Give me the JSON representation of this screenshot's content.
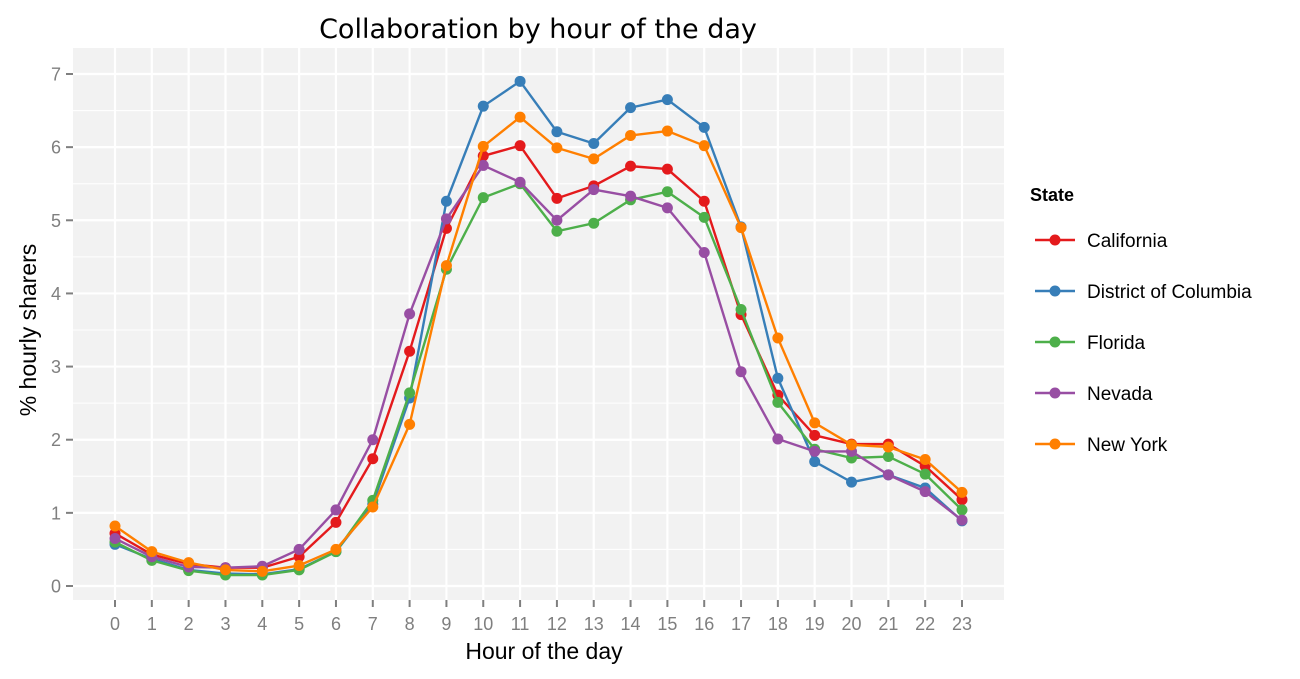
{
  "chart_data": {
    "type": "line",
    "title": "Collaboration by hour of the day",
    "xlabel": "Hour of the day",
    "ylabel": "%  hourly sharers",
    "x": [
      0,
      1,
      2,
      3,
      4,
      5,
      6,
      7,
      8,
      9,
      10,
      11,
      12,
      13,
      14,
      15,
      16,
      17,
      18,
      19,
      20,
      21,
      22,
      23
    ],
    "x_tick_labels": [
      "0",
      "1",
      "2",
      "3",
      "4",
      "5",
      "6",
      "7",
      "8",
      "9",
      "10",
      "11",
      "12",
      "13",
      "14",
      "15",
      "16",
      "17",
      "18",
      "19",
      "20",
      "21",
      "22",
      "23"
    ],
    "y_ticks": [
      0,
      1,
      2,
      3,
      4,
      5,
      6,
      7
    ],
    "y_tick_labels": [
      "0",
      "1",
      "2",
      "3",
      "4",
      "5",
      "6",
      "7"
    ],
    "ylim": [
      -0.2,
      7.3
    ],
    "xlim": [
      -1.2,
      24.2
    ],
    "grid": true,
    "legend": {
      "title": "State",
      "position": "right"
    },
    "series": [
      {
        "name": "California",
        "color": "#e41a1c",
        "values": [
          0.72,
          0.43,
          0.3,
          0.25,
          0.25,
          0.4,
          0.87,
          1.74,
          3.21,
          4.89,
          5.88,
          6.02,
          5.3,
          5.47,
          5.74,
          5.7,
          5.26,
          3.71,
          2.61,
          2.06,
          1.94,
          1.94,
          1.64,
          1.18
        ]
      },
      {
        "name": "District of Columbia",
        "color": "#377eb8",
        "values": [
          0.57,
          0.37,
          0.22,
          0.17,
          0.16,
          0.23,
          0.47,
          1.12,
          2.57,
          5.26,
          6.56,
          6.9,
          6.21,
          6.05,
          6.54,
          6.65,
          6.27,
          4.91,
          2.84,
          1.7,
          1.42,
          1.52,
          1.34,
          0.89
        ]
      },
      {
        "name": "Florida",
        "color": "#4daf4a",
        "values": [
          0.6,
          0.35,
          0.21,
          0.15,
          0.15,
          0.22,
          0.47,
          1.17,
          2.64,
          4.33,
          5.31,
          5.5,
          4.85,
          4.96,
          5.28,
          5.39,
          5.04,
          3.78,
          2.51,
          1.87,
          1.75,
          1.77,
          1.53,
          1.04
        ]
      },
      {
        "name": "Nevada",
        "color": "#984ea3",
        "values": [
          0.65,
          0.4,
          0.26,
          0.25,
          0.27,
          0.5,
          1.04,
          2.0,
          3.72,
          5.02,
          5.75,
          5.52,
          5.0,
          5.42,
          5.33,
          5.17,
          4.56,
          2.93,
          2.01,
          1.84,
          1.84,
          1.52,
          1.29,
          0.9
        ]
      },
      {
        "name": "New York",
        "color": "#ff7f00",
        "values": [
          0.82,
          0.47,
          0.32,
          0.22,
          0.2,
          0.28,
          0.5,
          1.08,
          2.21,
          4.38,
          6.01,
          6.41,
          5.99,
          5.84,
          6.16,
          6.22,
          6.02,
          4.9,
          3.39,
          2.23,
          1.93,
          1.9,
          1.73,
          1.28
        ]
      }
    ]
  },
  "colors": {
    "panel_background": "#f2f2f2",
    "grid": "#ffffff",
    "tick_text": "#7f7f7f",
    "tick_mark": "#7f7f7f"
  }
}
